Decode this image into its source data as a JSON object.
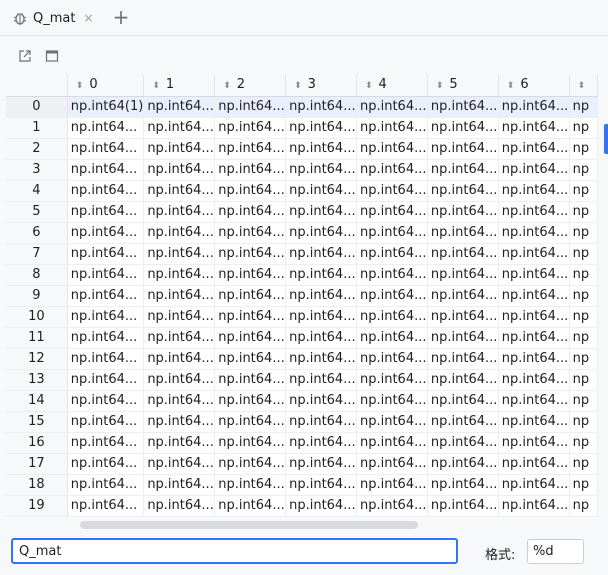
{
  "tab": {
    "title": "Q_mat",
    "close_glyph": "×",
    "icon": "bug-icon"
  },
  "add_tab_glyph": "+",
  "toolbar": {
    "open_icon": "external-link-icon",
    "window_icon": "window-icon"
  },
  "table": {
    "sort_glyph": "⬍",
    "columns": [
      "0",
      "1",
      "2",
      "3",
      "4",
      "5",
      "6",
      ""
    ],
    "rows": [
      {
        "index": "0",
        "cells": [
          "np.int64(1)",
          "np.int64...",
          "np.int64...",
          "np.int64...",
          "np.int64...",
          "np.int64...",
          "np.int64...",
          "np"
        ]
      },
      {
        "index": "1",
        "cells": [
          "np.int64...",
          "np.int64...",
          "np.int64...",
          "np.int64...",
          "np.int64...",
          "np.int64...",
          "np.int64...",
          "np"
        ]
      },
      {
        "index": "2",
        "cells": [
          "np.int64...",
          "np.int64...",
          "np.int64...",
          "np.int64...",
          "np.int64...",
          "np.int64...",
          "np.int64...",
          "np"
        ]
      },
      {
        "index": "3",
        "cells": [
          "np.int64...",
          "np.int64...",
          "np.int64...",
          "np.int64...",
          "np.int64...",
          "np.int64...",
          "np.int64...",
          "np"
        ]
      },
      {
        "index": "4",
        "cells": [
          "np.int64...",
          "np.int64...",
          "np.int64...",
          "np.int64...",
          "np.int64...",
          "np.int64...",
          "np.int64...",
          "np"
        ]
      },
      {
        "index": "5",
        "cells": [
          "np.int64...",
          "np.int64...",
          "np.int64...",
          "np.int64...",
          "np.int64...",
          "np.int64...",
          "np.int64...",
          "np"
        ]
      },
      {
        "index": "6",
        "cells": [
          "np.int64...",
          "np.int64...",
          "np.int64...",
          "np.int64...",
          "np.int64...",
          "np.int64...",
          "np.int64...",
          "np"
        ]
      },
      {
        "index": "7",
        "cells": [
          "np.int64...",
          "np.int64...",
          "np.int64...",
          "np.int64...",
          "np.int64...",
          "np.int64...",
          "np.int64...",
          "np"
        ]
      },
      {
        "index": "8",
        "cells": [
          "np.int64...",
          "np.int64...",
          "np.int64...",
          "np.int64...",
          "np.int64...",
          "np.int64...",
          "np.int64...",
          "np"
        ]
      },
      {
        "index": "9",
        "cells": [
          "np.int64...",
          "np.int64...",
          "np.int64...",
          "np.int64...",
          "np.int64...",
          "np.int64...",
          "np.int64...",
          "np"
        ]
      },
      {
        "index": "10",
        "cells": [
          "np.int64...",
          "np.int64...",
          "np.int64...",
          "np.int64...",
          "np.int64...",
          "np.int64...",
          "np.int64...",
          "np"
        ]
      },
      {
        "index": "11",
        "cells": [
          "np.int64...",
          "np.int64...",
          "np.int64...",
          "np.int64...",
          "np.int64...",
          "np.int64...",
          "np.int64...",
          "np"
        ]
      },
      {
        "index": "12",
        "cells": [
          "np.int64...",
          "np.int64...",
          "np.int64...",
          "np.int64...",
          "np.int64...",
          "np.int64...",
          "np.int64...",
          "np"
        ]
      },
      {
        "index": "13",
        "cells": [
          "np.int64...",
          "np.int64...",
          "np.int64...",
          "np.int64...",
          "np.int64...",
          "np.int64...",
          "np.int64...",
          "np"
        ]
      },
      {
        "index": "14",
        "cells": [
          "np.int64...",
          "np.int64...",
          "np.int64...",
          "np.int64...",
          "np.int64...",
          "np.int64...",
          "np.int64...",
          "np"
        ]
      },
      {
        "index": "15",
        "cells": [
          "np.int64...",
          "np.int64...",
          "np.int64...",
          "np.int64...",
          "np.int64...",
          "np.int64...",
          "np.int64...",
          "np"
        ]
      },
      {
        "index": "16",
        "cells": [
          "np.int64...",
          "np.int64...",
          "np.int64...",
          "np.int64...",
          "np.int64...",
          "np.int64...",
          "np.int64...",
          "np"
        ]
      },
      {
        "index": "17",
        "cells": [
          "np.int64...",
          "np.int64...",
          "np.int64...",
          "np.int64...",
          "np.int64...",
          "np.int64...",
          "np.int64...",
          "np"
        ]
      },
      {
        "index": "18",
        "cells": [
          "np.int64...",
          "np.int64...",
          "np.int64...",
          "np.int64...",
          "np.int64...",
          "np.int64...",
          "np.int64...",
          "np"
        ]
      },
      {
        "index": "19",
        "cells": [
          "np.int64...",
          "np.int64...",
          "np.int64...",
          "np.int64...",
          "np.int64...",
          "np.int64...",
          "np.int64...",
          "np"
        ]
      }
    ],
    "selected_row": 0
  },
  "bottom": {
    "expression_value": "Q_mat",
    "format_label": "格式:",
    "format_value": "%d"
  },
  "colors": {
    "accent": "#3574f0",
    "selection": "#e9effd",
    "header_bg": "#f7f8fa"
  }
}
